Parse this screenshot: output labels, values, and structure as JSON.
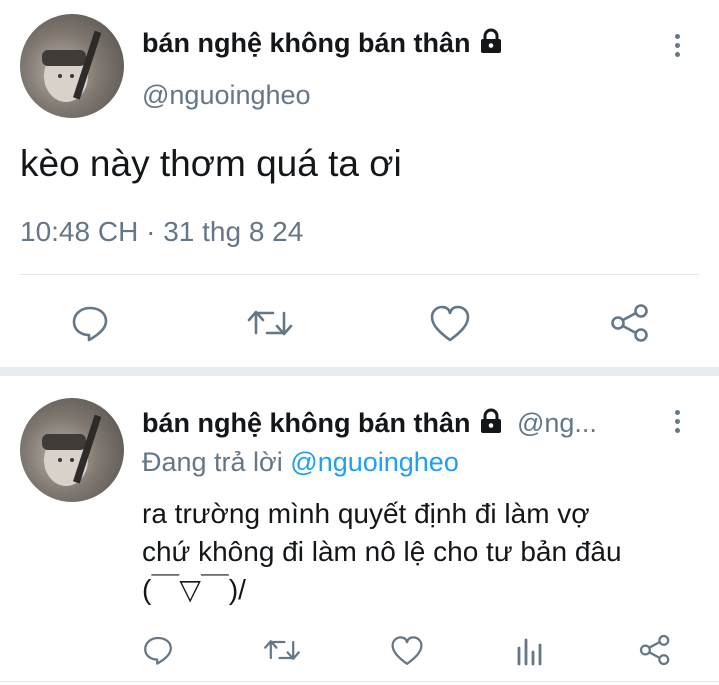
{
  "main_tweet": {
    "display_name": "bán nghệ không bán thân",
    "handle": "@nguoingheo",
    "text": "kèo này thơm quá ta ơi",
    "timestamp": "10:48 CH",
    "date": "31 thg 8 24",
    "separator": "·",
    "actions": [
      "reply-icon",
      "retweet-icon",
      "like-icon",
      "share-icon"
    ]
  },
  "reply_tweet": {
    "display_name": "bán nghệ không bán thân",
    "handle": "@ng...",
    "replying_prefix": "Đang trả lời",
    "replying_to": "@nguoingheo",
    "text_line1": "ra trường mình quyết định đi làm vợ",
    "text_line2": "chứ không đi làm nô lệ cho tư bản đâu",
    "text_line3": "(￣▽￣)/",
    "actions": [
      "reply-icon",
      "retweet-icon",
      "like-icon",
      "analytics-icon",
      "share-icon"
    ]
  },
  "colors": {
    "text": "#14171a",
    "secondary": "#657786",
    "link": "#1da1f2",
    "divider": "#e1e8ed"
  }
}
